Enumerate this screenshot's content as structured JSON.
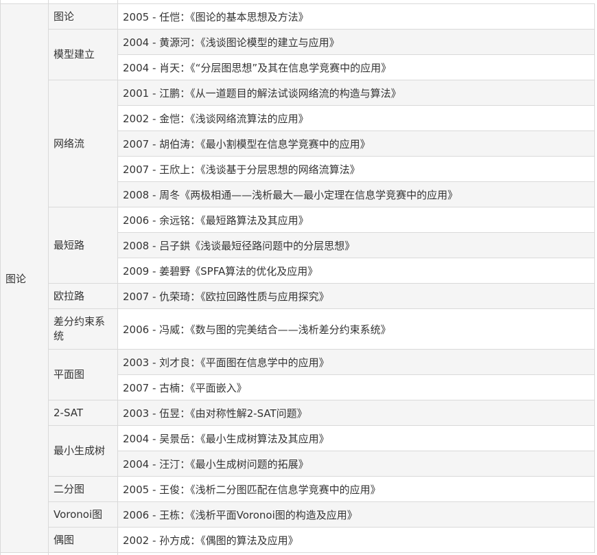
{
  "category": "图论",
  "rows": [
    {
      "sub": "图论",
      "rowspan": 1,
      "paper": "2005 - 任恺：《图论的基本思想及方法》",
      "h": 37
    },
    {
      "sub": "模型建立",
      "rowspan": 2,
      "paper": "2004 - 黄源河：《浅谈图论模型的建立与应用》",
      "h": 37
    },
    {
      "sub": null,
      "paper": "2004 - 肖天：《“分层图思想”及其在信息学竞赛中的应用》",
      "h": 37
    },
    {
      "sub": "网络流",
      "rowspan": 5,
      "paper": "2001 - 江鹏：《从一道题目的解法试谈网络流的构造与算法》",
      "h": 37
    },
    {
      "sub": null,
      "paper": "2002 - 金恺：《浅谈网络流算法的应用》",
      "h": 37
    },
    {
      "sub": null,
      "paper": "2007 - 胡伯涛：《最小割模型在信息学竞赛中的应用》",
      "h": 37
    },
    {
      "sub": null,
      "paper": "2007 - 王欣上：《浅谈基于分层思想的网络流算法》",
      "h": 37
    },
    {
      "sub": null,
      "paper": "2008 - 周冬《两极相通——浅析最大—最小定理在信息学竞赛中的应用》",
      "h": 37
    },
    {
      "sub": "最短路",
      "rowspan": 3,
      "paper": "2006 - 余远铭：《最短路算法及其应用》",
      "h": 37
    },
    {
      "sub": null,
      "paper": "2008 - 吕子鉷《浅谈最短径路问题中的分层思想》",
      "h": 37
    },
    {
      "sub": null,
      "paper": "2009 - 姜碧野《SPFA算法的优化及应用》",
      "h": 37
    },
    {
      "sub": "欧拉路",
      "rowspan": 1,
      "paper": "2007 - 仇荣琦：《欧拉回路性质与应用探究》",
      "h": 37
    },
    {
      "sub": "差分约束系统",
      "rowspan": 1,
      "paper": "2006 - 冯威：《数与图的完美结合——浅析差分约束系统》",
      "h": 59
    },
    {
      "sub": "平面图",
      "rowspan": 2,
      "paper": "2003 - 刘才良：《平面图在信息学中的应用》",
      "h": 37
    },
    {
      "sub": null,
      "paper": "2007 - 古楠：《平面嵌入》",
      "h": 37
    },
    {
      "sub": "2-SAT",
      "rowspan": 1,
      "paper": "2003 - 伍昱：《由对称性解2-SAT问题》",
      "h": 37
    },
    {
      "sub": "最小生成树",
      "rowspan": 2,
      "paper": "2004 - 吴景岳：《最小生成树算法及其应用》",
      "h": 37
    },
    {
      "sub": null,
      "paper": "2004 - 汪汀：《最小生成树问题的拓展》",
      "h": 37
    },
    {
      "sub": "二分图",
      "rowspan": 1,
      "paper": "2005 - 王俊：《浅析二分图匹配在信息学竞赛中的应用》",
      "h": 37
    },
    {
      "sub": "Voronoi图",
      "rowspan": 1,
      "paper": "2006 - 王栋：《浅析平面Voronoi图的构造及应用》",
      "h": 37
    },
    {
      "sub": "偶图",
      "rowspan": 1,
      "paper": "2002 - 孙方成：《偶图的算法及应用》",
      "h": 37
    }
  ]
}
